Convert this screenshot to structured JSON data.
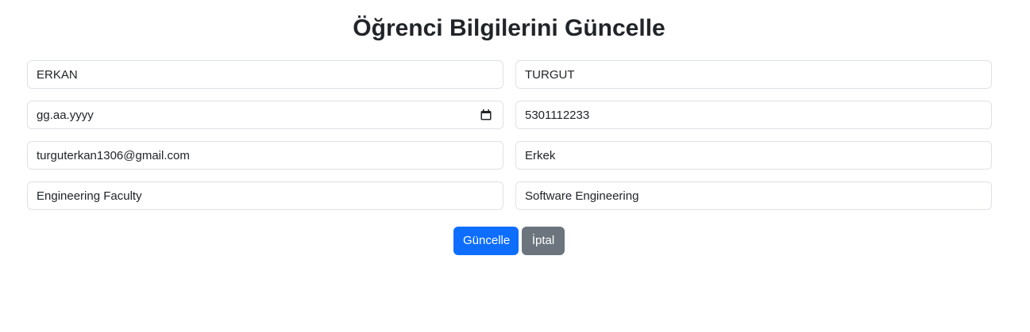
{
  "page": {
    "title": "Öğrenci Bilgilerini Güncelle"
  },
  "form": {
    "first_name": {
      "value": "ERKAN"
    },
    "last_name": {
      "value": "TURGUT"
    },
    "birth_date": {
      "value": "gg.aa.yyyy",
      "icon": "calendar-icon"
    },
    "phone": {
      "value": "5301112233"
    },
    "email": {
      "value": "turguterkan1306@gmail.com"
    },
    "gender": {
      "value": "Erkek"
    },
    "faculty": {
      "value": "Engineering Faculty"
    },
    "department": {
      "value": "Software Engineering"
    }
  },
  "actions": {
    "update_label": "Güncelle",
    "cancel_label": "İptal"
  },
  "colors": {
    "primary": "#0d6efd",
    "secondary": "#6c757d",
    "border": "#dee2e6",
    "text": "#212529"
  }
}
